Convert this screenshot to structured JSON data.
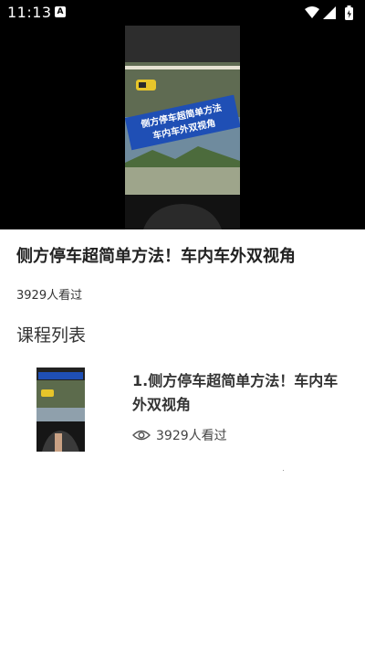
{
  "status_bar": {
    "time": "11:13",
    "notification_badge": "A"
  },
  "video": {
    "overlay_line1": "侧方停车超简单方法",
    "overlay_line2": "车内车外双视角"
  },
  "course": {
    "title": "侧方停车超简单方法！车内车外双视角",
    "views": "3929人看过"
  },
  "section": {
    "title": "课程列表"
  },
  "course_list": [
    {
      "title": "1.侧方停车超简单方法！车内车外双视角",
      "views": "3929人看过",
      "icon": "eye-icon"
    }
  ],
  "colors": {
    "status_bar_bg": "#000000",
    "overlay_banner": "#1f4fb5"
  }
}
